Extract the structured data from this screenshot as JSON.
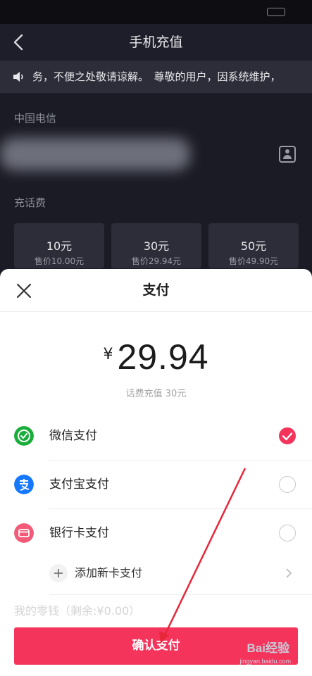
{
  "header": {
    "title": "手机充值"
  },
  "notice": {
    "text": "务，不便之处敬请谅解。　尊敬的用户，因系统维护，"
  },
  "carrier": "中国电信",
  "recharge": {
    "title": "充话费",
    "cards": [
      {
        "amount": "10元",
        "price": "售价10.00元"
      },
      {
        "amount": "30元",
        "price": "售价29.94元"
      },
      {
        "amount": "50元",
        "price": "售价49.90元"
      }
    ]
  },
  "sheet": {
    "title": "支付",
    "currency": "¥",
    "price": "29.94",
    "subtitle": "话费充值 30元",
    "methods": [
      {
        "label": "微信支付",
        "icon": "wechat-pay-icon",
        "color": "#19ad3a",
        "selected": true
      },
      {
        "label": "支付宝支付",
        "icon": "alipay-icon",
        "color": "#1677ff",
        "selected": false
      },
      {
        "label": "银行卡支付",
        "icon": "bank-card-icon",
        "color": "#f25a78",
        "selected": false
      }
    ],
    "add_card": "添加新卡支付",
    "faded_row": "我的零钱（剩余:¥0.00）",
    "confirm": "确认支付"
  },
  "watermark": {
    "text": "Bai经验",
    "url": "jingyan.baidu.com"
  },
  "colors": {
    "accent": "#f5345c",
    "dark_bg": "#1a1b25",
    "card_bg": "#2c2d38",
    "arrow": "#e8263a"
  }
}
